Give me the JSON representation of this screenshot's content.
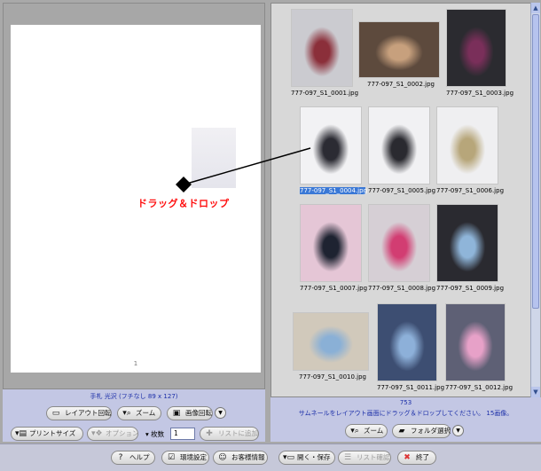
{
  "preview": {
    "page_number": "1"
  },
  "drag_annotation": {
    "label": "ドラッグ＆ドロップ"
  },
  "thumbnails": [
    {
      "name": "777-097_S1_0001.jpg",
      "selected": false
    },
    {
      "name": "777-097_S1_0002.jpg",
      "selected": false
    },
    {
      "name": "777-097_S1_0003.jpg",
      "selected": false
    },
    {
      "name": "777-097_S1_0004.jpg",
      "selected": true
    },
    {
      "name": "777-097_S1_0005.jpg",
      "selected": false
    },
    {
      "name": "777-097_S1_0006.jpg",
      "selected": false
    },
    {
      "name": "777-097_S1_0007.jpg",
      "selected": false
    },
    {
      "name": "777-097_S1_0008.jpg",
      "selected": false
    },
    {
      "name": "777-097_S1_0009.jpg",
      "selected": false
    },
    {
      "name": "777-097_S1_0010.jpg",
      "selected": false
    },
    {
      "name": "777-097_S1_0011.jpg",
      "selected": false
    },
    {
      "name": "777-097_S1_0012.jpg",
      "selected": false
    }
  ],
  "left_controls": {
    "size_label": "手札 光沢 (フチなし 89 x 127)",
    "layout_rotate": "レイアウト回転",
    "zoom": "ズーム",
    "image_rotate": "画像回転",
    "print_size": "プリントサイズ",
    "options": "オプション",
    "copies_label": "枚数",
    "copies_value": "1",
    "add_to_list": "リストに追加"
  },
  "info_area": {
    "count": "753",
    "message": "サムネールをレイアウト画面にドラッグ＆ドロップしてください。 15画像。",
    "zoom": "ズーム",
    "folder_select": "フォルダ選択"
  },
  "bottom_bar": {
    "help": "ヘルプ",
    "settings": "環境設定",
    "customer_info": "お客様情報",
    "open_save": "開く・保存",
    "list_confirm": "リスト確認",
    "exit": "終了"
  }
}
